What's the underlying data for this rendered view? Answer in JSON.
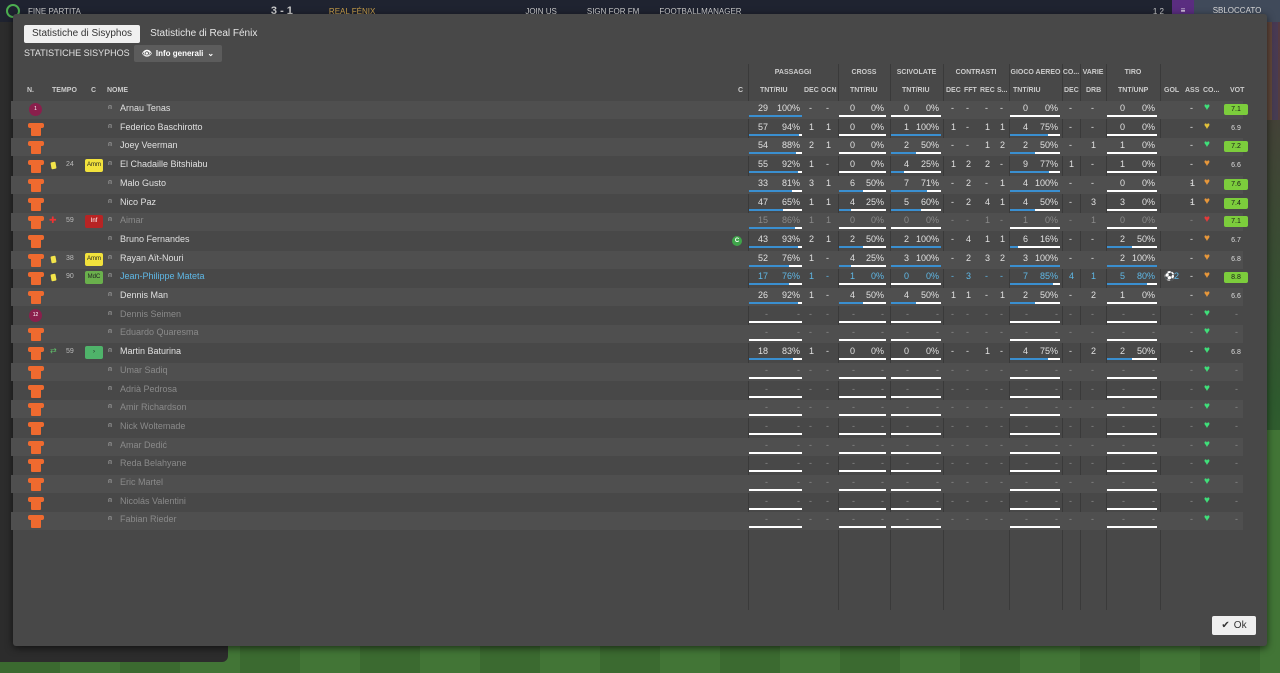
{
  "topbar": {
    "left_label": "FINE PARTITA",
    "score": "3 - 1",
    "away_team": "REAL FÉNIX",
    "right_label": "SBLOCCATO",
    "mid_labels": [
      "JOIN US",
      "SIGN FOR FM",
      "FOOTBALLMANAGER"
    ],
    "right_num": "1 2"
  },
  "tabs": [
    "Statistiche di Sisyphos",
    "Statistiche di Real Fénix"
  ],
  "subheader": {
    "label": "STATISTICHE SISYPHOS",
    "dropdown": "Info generali"
  },
  "ok_label": "Ok",
  "groups": [
    "PASSAGGI",
    "CROSS",
    "SCIVOLATE",
    "CONTRASTI",
    "GIOCO AEREO",
    "CO...",
    "VARIE",
    "TIRO"
  ],
  "headers": {
    "n": "N.",
    "tempo": "TEMPO",
    "c": "C",
    "nome": "NOME",
    "cap": "C",
    "pas": "TNT/RIU",
    "dec": "DEC",
    "ocn": "OCN",
    "cross": "TNT/RIU",
    "sciv": "TNT/RIU",
    "cdec": "DEC",
    "fft": "FFT",
    "rec": "REC",
    "s": "S...",
    "aer": "TNT/RIU",
    "codec": "DEC",
    "drb": "DRB",
    "tiro": "TNT/UNP",
    "gol": "GOL",
    "ass": "ASS",
    "co": "CO...",
    "vot": "VOT"
  },
  "colors": {
    "shirt": "#ef6a2f",
    "gk": "#8a1f4c",
    "vote_high": "#7ccd3c",
    "vote_mid": "#9fd84a",
    "bar_fill": "#3a8fd0",
    "heart_green": "#3fe07a",
    "heart_orange": "#e7973a",
    "heart_yellow": "#e2c13a"
  },
  "rows": [
    {
      "name": "Arnau Tenas",
      "gk": "1",
      "tempo": "",
      "badge": "",
      "badge_color": "",
      "card": "",
      "pas": [
        "29",
        "100%"
      ],
      "pas_pct": 1,
      "dec": "-",
      "ocn": "-",
      "cross": [
        "0",
        "0%"
      ],
      "cross_pct": 0,
      "sciv": [
        "0",
        "0%"
      ],
      "sciv_pct": 0,
      "cdec": "-",
      "fft": "-",
      "rec": "-",
      "s": "-",
      "aer": [
        "0",
        "0%"
      ],
      "aer_pct": 0,
      "codec": "-",
      "drb": "-",
      "tiro": [
        "0",
        "0%"
      ],
      "tiro_pct": 0,
      "gol": "",
      "ass": "-",
      "heart": "green",
      "vot": "7.1",
      "vot_c": "high"
    },
    {
      "name": "Federico Baschirotto",
      "tempo": "",
      "pas": [
        "57",
        "94%"
      ],
      "pas_pct": 0.94,
      "dec": "1",
      "ocn": "1",
      "cross": [
        "0",
        "0%"
      ],
      "cross_pct": 0,
      "sciv": [
        "1",
        "100%"
      ],
      "sciv_pct": 1,
      "cdec": "1",
      "fft": "-",
      "rec": "1",
      "s": "1",
      "aer": [
        "4",
        "75%"
      ],
      "aer_pct": 0.75,
      "codec": "-",
      "drb": "-",
      "tiro": [
        "0",
        "0%"
      ],
      "tiro_pct": 0,
      "gol": "",
      "ass": "-",
      "heart": "yellow",
      "vot": "6.9",
      "vot_c": "none"
    },
    {
      "name": "Joey Veerman",
      "tempo": "",
      "pas": [
        "54",
        "88%"
      ],
      "pas_pct": 0.88,
      "dec": "2",
      "ocn": "1",
      "cross": [
        "0",
        "0%"
      ],
      "cross_pct": 0,
      "sciv": [
        "2",
        "50%"
      ],
      "sciv_pct": 0.5,
      "cdec": "-",
      "fft": "-",
      "rec": "1",
      "s": "2",
      "aer": [
        "2",
        "50%"
      ],
      "aer_pct": 0.5,
      "codec": "-",
      "drb": "1",
      "tiro": [
        "1",
        "0%"
      ],
      "tiro_pct": 0,
      "gol": "",
      "ass": "-",
      "heart": "green",
      "vot": "7.2",
      "vot_c": "high"
    },
    {
      "name": "El Chadaille Bitshiabu",
      "tempo": "24",
      "badge": "Amm",
      "badge_color": "#f2e23c",
      "card": "yellow",
      "pas": [
        "55",
        "92%"
      ],
      "pas_pct": 0.92,
      "dec": "1",
      "ocn": "-",
      "cross": [
        "0",
        "0%"
      ],
      "cross_pct": 0,
      "sciv": [
        "4",
        "25%"
      ],
      "sciv_pct": 0.25,
      "cdec": "1",
      "fft": "2",
      "rec": "2",
      "s": "-",
      "aer": [
        "9",
        "77%"
      ],
      "aer_pct": 0.77,
      "codec": "1",
      "drb": "-",
      "tiro": [
        "1",
        "0%"
      ],
      "tiro_pct": 0,
      "gol": "",
      "ass": "-",
      "heart": "orange",
      "vot": "6.6",
      "vot_c": "none"
    },
    {
      "name": "Malo Gusto",
      "tempo": "",
      "pas": [
        "33",
        "81%"
      ],
      "pas_pct": 0.81,
      "dec": "3",
      "ocn": "1",
      "cross": [
        "6",
        "50%"
      ],
      "cross_pct": 0.5,
      "sciv": [
        "7",
        "71%"
      ],
      "sciv_pct": 0.71,
      "cdec": "-",
      "fft": "2",
      "rec": "-",
      "s": "1",
      "aer": [
        "4",
        "100%"
      ],
      "aer_pct": 1,
      "codec": "-",
      "drb": "-",
      "tiro": [
        "0",
        "0%"
      ],
      "tiro_pct": 0,
      "gol": "1",
      "ass": "-",
      "heart": "orange",
      "vot": "7.6",
      "vot_c": "high"
    },
    {
      "name": "Nico Paz",
      "tempo": "",
      "pas": [
        "47",
        "65%"
      ],
      "pas_pct": 0.65,
      "dec": "1",
      "ocn": "1",
      "cross": [
        "4",
        "25%"
      ],
      "cross_pct": 0.25,
      "sciv": [
        "5",
        "60%"
      ],
      "sciv_pct": 0.6,
      "cdec": "-",
      "fft": "2",
      "rec": "4",
      "s": "1",
      "aer": [
        "4",
        "50%"
      ],
      "aer_pct": 0.5,
      "codec": "-",
      "drb": "3",
      "tiro": [
        "3",
        "0%"
      ],
      "tiro_pct": 0,
      "gol": "1",
      "ass": "-",
      "heart": "orange",
      "vot": "7.4",
      "vot_c": "high"
    },
    {
      "name": "Aimar",
      "muted": true,
      "tempo": "59",
      "badge": "Inf",
      "badge_color": "#b82424",
      "card": "injury",
      "pas": [
        "15",
        "86%"
      ],
      "pas_pct": 0.86,
      "dec": "1",
      "ocn": "1",
      "cross": [
        "0",
        "0%"
      ],
      "cross_pct": 0,
      "sciv": [
        "0",
        "0%"
      ],
      "sciv_pct": 0,
      "cdec": "-",
      "fft": "-",
      "rec": "1",
      "s": "-",
      "aer": [
        "1",
        "0%"
      ],
      "aer_pct": 0,
      "codec": "-",
      "drb": "1",
      "tiro": [
        "0",
        "0%"
      ],
      "tiro_pct": 0,
      "gol": "",
      "ass": "-",
      "heart": "red",
      "vot": "7.1",
      "vot_c": "high"
    },
    {
      "name": "Bruno Fernandes",
      "tempo": "",
      "captain": "C",
      "pas": [
        "43",
        "93%"
      ],
      "pas_pct": 0.93,
      "dec": "2",
      "ocn": "1",
      "cross": [
        "2",
        "50%"
      ],
      "cross_pct": 0.5,
      "sciv": [
        "2",
        "100%"
      ],
      "sciv_pct": 1,
      "cdec": "-",
      "fft": "4",
      "rec": "1",
      "s": "1",
      "aer": [
        "6",
        "16%"
      ],
      "aer_pct": 0.16,
      "codec": "-",
      "drb": "-",
      "tiro": [
        "2",
        "50%"
      ],
      "tiro_pct": 0.5,
      "gol": "",
      "ass": "-",
      "heart": "orange",
      "vot": "6.7",
      "vot_c": "none"
    },
    {
      "name": "Rayan Aït-Nouri",
      "tempo": "38",
      "badge": "Amm",
      "badge_color": "#f2e23c",
      "card": "yellow",
      "pas": [
        "52",
        "76%"
      ],
      "pas_pct": 0.76,
      "dec": "1",
      "ocn": "-",
      "cross": [
        "4",
        "25%"
      ],
      "cross_pct": 0.25,
      "sciv": [
        "3",
        "100%"
      ],
      "sciv_pct": 1,
      "cdec": "-",
      "fft": "2",
      "rec": "3",
      "s": "2",
      "aer": [
        "3",
        "100%"
      ],
      "aer_pct": 1,
      "codec": "-",
      "drb": "-",
      "tiro": [
        "2",
        "100%"
      ],
      "tiro_pct": 1,
      "gol": "",
      "ass": "-",
      "heart": "orange",
      "vot": "6.8",
      "vot_c": "none"
    },
    {
      "name": "Jean-Philippe Mateta",
      "selected": true,
      "tempo": "90",
      "badge": "MdC",
      "badge_color": "#6ab04c",
      "card": "yellow",
      "pas": [
        "17",
        "76%"
      ],
      "pas_pct": 0.76,
      "dec": "1",
      "ocn": "-",
      "cross": [
        "1",
        "0%"
      ],
      "cross_pct": 0,
      "sciv": [
        "0",
        "0%"
      ],
      "sciv_pct": 0,
      "cdec": "-",
      "fft": "3",
      "rec": "-",
      "s": "-",
      "aer": [
        "7",
        "85%"
      ],
      "aer_pct": 0.85,
      "codec": "4",
      "drb": "1",
      "tiro": [
        "5",
        "80%"
      ],
      "tiro_pct": 0.8,
      "gol": "2",
      "ass": "-",
      "heart": "orange",
      "vot": "8.8",
      "vot_c": "high"
    },
    {
      "name": "Dennis Man",
      "tempo": "",
      "pas": [
        "26",
        "92%"
      ],
      "pas_pct": 0.92,
      "dec": "1",
      "ocn": "-",
      "cross": [
        "4",
        "50%"
      ],
      "cross_pct": 0.5,
      "sciv": [
        "4",
        "50%"
      ],
      "sciv_pct": 0.5,
      "cdec": "1",
      "fft": "1",
      "rec": "-",
      "s": "1",
      "aer": [
        "2",
        "50%"
      ],
      "aer_pct": 0.5,
      "codec": "-",
      "drb": "2",
      "tiro": [
        "1",
        "0%"
      ],
      "tiro_pct": 0,
      "gol": "",
      "ass": "-",
      "heart": "orange",
      "vot": "6.6",
      "vot_c": "none"
    },
    {
      "name": "Dennis Seimen",
      "gk": "12",
      "muted": true,
      "empty": true,
      "heart": "green"
    },
    {
      "name": "Eduardo Quaresma",
      "muted": true,
      "empty": true,
      "heart": "green"
    },
    {
      "name": "Martin Baturina",
      "tempo": "59",
      "badge": "›",
      "badge_color": "#4fb36a",
      "card": "sub",
      "pas": [
        "18",
        "83%"
      ],
      "pas_pct": 0.83,
      "dec": "1",
      "ocn": "-",
      "cross": [
        "0",
        "0%"
      ],
      "cross_pct": 0,
      "sciv": [
        "0",
        "0%"
      ],
      "sciv_pct": 0,
      "cdec": "-",
      "fft": "-",
      "rec": "1",
      "s": "-",
      "aer": [
        "4",
        "75%"
      ],
      "aer_pct": 0.75,
      "codec": "-",
      "drb": "2",
      "tiro": [
        "2",
        "50%"
      ],
      "tiro_pct": 0.5,
      "gol": "",
      "ass": "-",
      "heart": "green",
      "vot": "6.8",
      "vot_c": "none"
    },
    {
      "name": "Umar Sadiq",
      "muted": true,
      "empty": true,
      "heart": "green"
    },
    {
      "name": "Adrià Pedrosa",
      "muted": true,
      "empty": true,
      "heart": "green"
    },
    {
      "name": "Amir Richardson",
      "muted": true,
      "empty": true,
      "heart": "green"
    },
    {
      "name": "Nick Woltemade",
      "muted": true,
      "empty": true,
      "heart": "green"
    },
    {
      "name": "Amar Dedić",
      "muted": true,
      "empty": true,
      "heart": "green"
    },
    {
      "name": "Reda Belahyane",
      "muted": true,
      "empty": true,
      "heart": "green"
    },
    {
      "name": "Eric Martel",
      "muted": true,
      "empty": true,
      "heart": "green"
    },
    {
      "name": "Nicolás Valentini",
      "muted": true,
      "empty": true,
      "heart": "green"
    },
    {
      "name": "Fabian Rieder",
      "muted": true,
      "empty": true,
      "heart": "green"
    }
  ]
}
